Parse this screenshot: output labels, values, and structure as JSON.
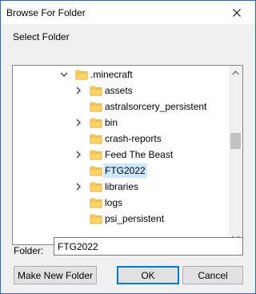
{
  "window": {
    "title": "Browse For Folder"
  },
  "instruction": "Select Folder",
  "tree": {
    "items": [
      {
        "label": ".minecraft",
        "expander": "down",
        "level": 0
      },
      {
        "label": "assets",
        "expander": "right",
        "level": 1
      },
      {
        "label": "astralsorcery_persistent",
        "expander": "none",
        "level": 1
      },
      {
        "label": "bin",
        "expander": "right",
        "level": 1
      },
      {
        "label": "crash-reports",
        "expander": "none",
        "level": 1
      },
      {
        "label": "Feed The Beast",
        "expander": "right",
        "level": 1
      },
      {
        "label": "FTG2022",
        "expander": "none",
        "level": 1,
        "selected": true
      },
      {
        "label": "libraries",
        "expander": "right",
        "level": 1
      },
      {
        "label": "logs",
        "expander": "none",
        "level": 1
      },
      {
        "label": "psi_persistent",
        "expander": "none",
        "level": 1
      }
    ]
  },
  "folder_field": {
    "label": "Folder:",
    "value": "FTG2022"
  },
  "buttons": {
    "make_new_folder": "Make New Folder",
    "ok": "OK",
    "cancel": "Cancel"
  },
  "colors": {
    "folder_icon": "#ffd56b",
    "selection": "#cce8ff",
    "accent_border": "#1f6bc7"
  },
  "icons": {
    "close": "close-icon",
    "folder": "folder-icon",
    "expand": "chevron-right-icon",
    "collapse": "chevron-down-icon",
    "scroll_up": "scroll-up-arrow-icon",
    "scroll_down": "scroll-down-arrow-icon"
  }
}
